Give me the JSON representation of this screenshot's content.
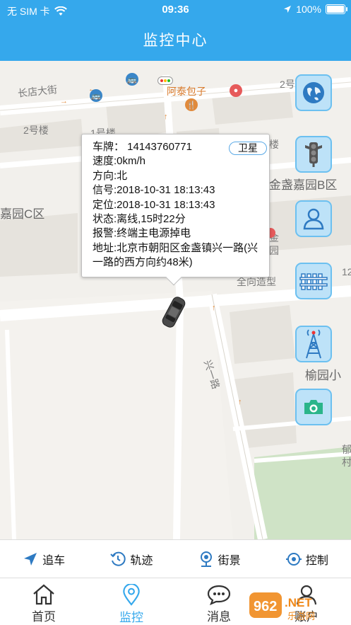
{
  "status": {
    "carrier": "无 SIM 卡",
    "time": "09:36",
    "battery": "100%",
    "battery_level": 1.0
  },
  "header": {
    "title": "监控中心"
  },
  "map_labels": {
    "changdian": "长店大街",
    "bld2_left": "2号楼",
    "bld1": "1号楼",
    "bld2_right": "2号",
    "atai": "阿泰包子",
    "jinzhan_b": "金盏嘉园B区",
    "jiayuan_c": "嘉园C区",
    "lou": "楼",
    "jin": "金",
    "yuan": "园",
    "quanxiang": "全向造型",
    "num12": "12",
    "xingyilu": "兴一路",
    "yuyuan": "榆园小",
    "yucun": "郁\n村"
  },
  "popup": {
    "plate": "车牌： 14143760771",
    "speed": "速度:0km/h",
    "direction": "方向:北",
    "signal": "信号:2018-10-31 18:13:43",
    "position": "定位:2018-10-31 18:13:43",
    "state": "状态:离线,15时22分",
    "alarm": "报警:终端主电源掉电",
    "address": "地址:北京市朝阳区金盏镇兴一路(兴一路的西方向约48米)",
    "satellite_btn": "卫星"
  },
  "tools": [
    {
      "icon": "globe-icon"
    },
    {
      "icon": "traffic-light-icon"
    },
    {
      "icon": "street-person-icon"
    },
    {
      "icon": "fence-icon"
    },
    {
      "icon": "signal-tower-icon"
    },
    {
      "icon": "camera-icon"
    }
  ],
  "actions": [
    {
      "label": "追车",
      "icon": "navigation-arrow-icon"
    },
    {
      "label": "轨迹",
      "icon": "history-clock-icon"
    },
    {
      "label": "街景",
      "icon": "street-view-icon"
    },
    {
      "label": "控制",
      "icon": "control-target-icon"
    }
  ],
  "tabs": [
    {
      "label": "首页",
      "icon": "home-icon"
    },
    {
      "label": "监控",
      "icon": "location-pin-icon",
      "active": true
    },
    {
      "label": "消息",
      "icon": "chat-bubble-icon"
    },
    {
      "label": "账户",
      "icon": "account-icon"
    }
  ],
  "watermark": {
    "brand": "962.NET",
    "sub": "乐游网"
  },
  "colors": {
    "accent": "#35a8ec",
    "tool_bg": "#bde2f8",
    "tool_border": "#6cc0f0"
  }
}
